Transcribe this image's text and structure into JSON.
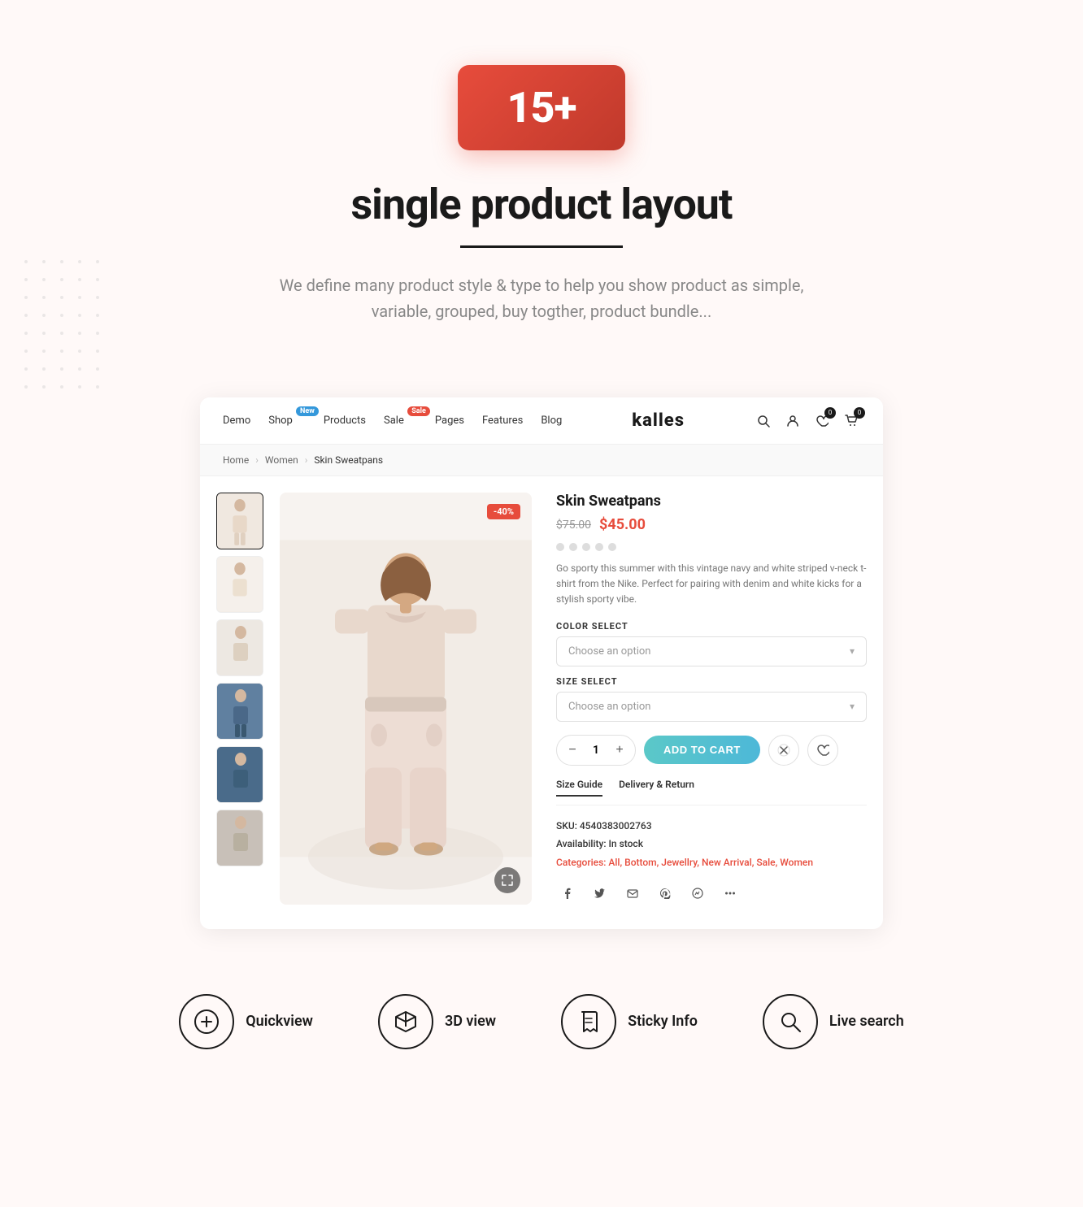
{
  "hero": {
    "badge": "15+",
    "title": "single product layout",
    "description": "We define many product style & type to help you show product as simple, variable, grouped, buy togther, product bundle..."
  },
  "navbar": {
    "links": [
      {
        "label": "Demo",
        "badge": null
      },
      {
        "label": "Shop",
        "badge": "New",
        "badgeType": "new"
      },
      {
        "label": "Products",
        "badge": null
      },
      {
        "label": "Sale",
        "badge": "Sale",
        "badgeType": "sale"
      },
      {
        "label": "Pages",
        "badge": null
      },
      {
        "label": "Features",
        "badge": null
      },
      {
        "label": "Blog",
        "badge": null
      }
    ],
    "brand": "kalles",
    "wishlist_count": "0",
    "cart_count": "0"
  },
  "breadcrumb": {
    "home": "Home",
    "category": "Women",
    "product": "Skin Sweatpans"
  },
  "product": {
    "name": "Skin Sweatpans",
    "price_original": "$75.00",
    "price_sale": "$45.00",
    "discount": "-40%",
    "description": "Go sporty this summer with this vintage navy and white striped v-neck t-shirt from the Nike. Perfect for pairing with denim and white kicks for a stylish sporty vibe.",
    "color_label": "COLOR SELECT",
    "color_placeholder": "Choose an option",
    "size_label": "SIZE SELECT",
    "size_placeholder": "Choose an option",
    "qty": "1",
    "add_to_cart": "ADD TO CART",
    "tab_size_guide": "Size Guide",
    "tab_delivery": "Delivery & Return",
    "sku_label": "SKU:",
    "sku_value": "4540383002763",
    "availability_label": "Availability:",
    "availability_value": "In stock",
    "categories_label": "Categories:",
    "categories_value": "All, Bottom, Jewellry, New Arrival, Sale, Women"
  },
  "features": [
    {
      "icon": "plus-circle",
      "label": "Quickview",
      "unicode": "⊕"
    },
    {
      "icon": "box-3d",
      "label": "3D view",
      "unicode": "⬡"
    },
    {
      "icon": "bookmark",
      "label": "Sticky Info",
      "unicode": "🔖"
    },
    {
      "icon": "search",
      "label": "Live search",
      "unicode": "🔍"
    }
  ],
  "colors": {
    "brand_red": "#e74c3c",
    "brand_teal": "#4db8d8",
    "text_dark": "#1a1a1a",
    "text_gray": "#777"
  }
}
